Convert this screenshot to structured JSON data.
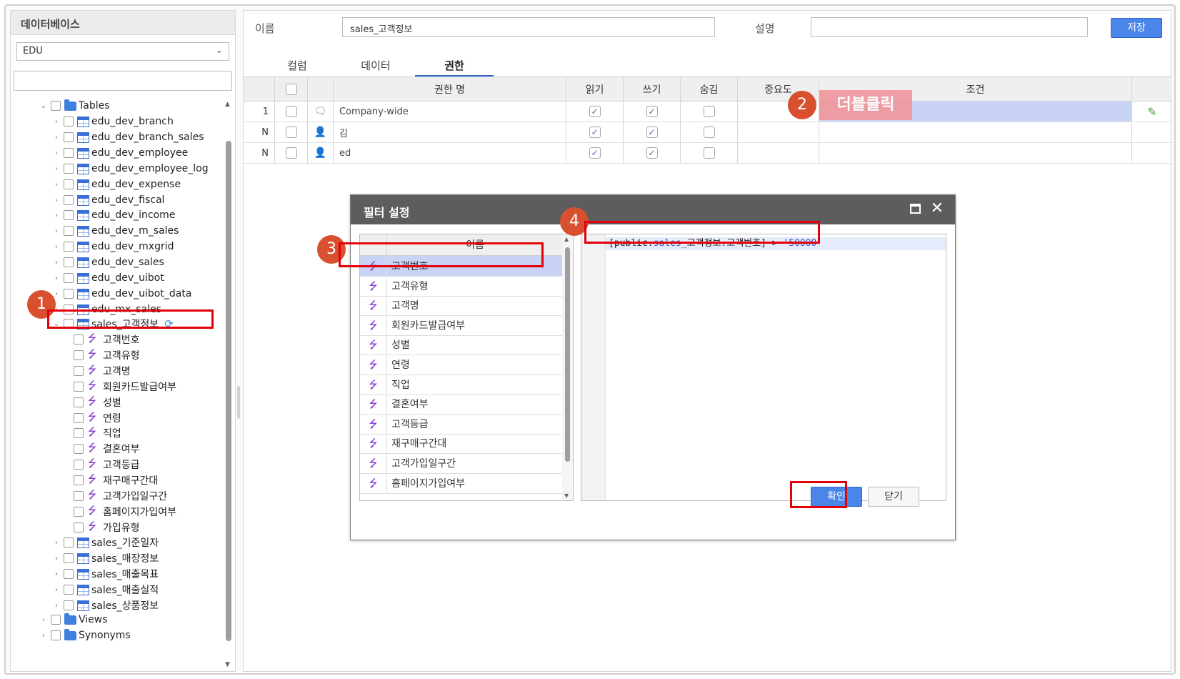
{
  "left_panel": {
    "title": "데이터베이스",
    "db_select": "EDU",
    "tree_search_placeholder": "",
    "tables_folder": "Tables",
    "tables": [
      "edu_dev_branch",
      "edu_dev_branch_sales",
      "edu_dev_employee",
      "edu_dev_employee_log",
      "edu_dev_expense",
      "edu_dev_fiscal",
      "edu_dev_income",
      "edu_dev_m_sales",
      "edu_dev_mxgrid",
      "edu_dev_sales",
      "edu_dev_uibot",
      "edu_dev_uibot_data",
      "edu_mx_sales"
    ],
    "expanded_table": "sales_고객정보",
    "columns": [
      "고객번호",
      "고객유형",
      "고객명",
      "회원카드발급여부",
      "성별",
      "연령",
      "직업",
      "결혼여부",
      "고객등급",
      "재구매구간대",
      "고객가입일구간",
      "홈페이지가입여부",
      "가입유형"
    ],
    "tables_after": [
      "sales_기준일자",
      "sales_매장정보",
      "sales_매출목표",
      "sales_매출실적",
      "sales_상품정보"
    ],
    "views_folder": "Views",
    "synonyms_folder": "Synonyms"
  },
  "form": {
    "name_label": "이름",
    "name_value": "sales_고객정보",
    "desc_label": "설명",
    "desc_value": "",
    "save_label": "저장"
  },
  "tabs": [
    "컬럼",
    "데이터",
    "권한"
  ],
  "active_tab": "권한",
  "grid": {
    "headers": {
      "name": "권한 명",
      "read": "읽기",
      "write": "쓰기",
      "hide": "숨김",
      "importance": "중요도",
      "condition": "조건"
    },
    "rows": [
      {
        "num": "1",
        "icon": "chat-icon",
        "name": "Company-wide",
        "read": true,
        "write": true,
        "hide": false
      },
      {
        "num": "N",
        "icon": "user-icon",
        "name": "김",
        "read": true,
        "write": true,
        "hide": false
      },
      {
        "num": "N",
        "icon": "user-icon",
        "name": "ed",
        "read": true,
        "write": true,
        "hide": false
      }
    ]
  },
  "annotations": {
    "badge1": "1",
    "badge2": "2",
    "badge3": "3",
    "badge4": "4",
    "double_click": "더블클릭"
  },
  "dialog": {
    "title": "필터 설정",
    "list_header": "이름",
    "items": [
      "고객번호",
      "고객유형",
      "고객명",
      "회원카드발급여부",
      "성별",
      "연령",
      "직업",
      "결혼여부",
      "고객등급",
      "재구매구간대",
      "고객가입일구간",
      "홈페이지가입여부"
    ],
    "selected_item": "고객번호",
    "expr_open": "[public.",
    "expr_schema": "sales_",
    "expr_mid": "고객정보.고객번호] > ",
    "expr_value": "'50000'",
    "ok_label": "확인",
    "close_label": "닫기"
  },
  "colors": {
    "accent": "#4a86e8",
    "highlight": "#e3000b",
    "badge": "#d9502f",
    "selection": "#c9d3f6",
    "column_icon": "#8a3fd1"
  }
}
